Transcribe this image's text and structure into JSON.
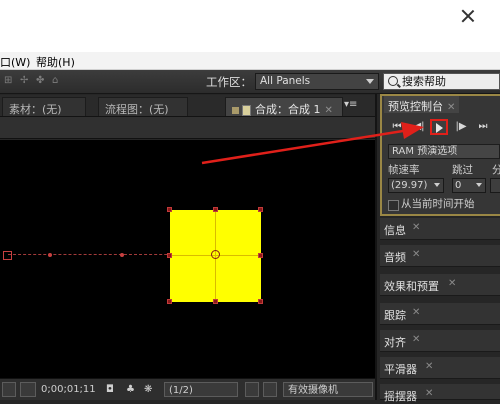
{
  "menubar": {
    "window": "口(W)",
    "help": "帮助(H)"
  },
  "toolbar": {
    "workspace_label": "工作区：",
    "workspace_value": "All Panels",
    "search_value": "搜索帮助"
  },
  "tabs": [
    {
      "label": "素材：(无)"
    },
    {
      "label": "流程图：(无)"
    },
    {
      "label": "合成：合成 1"
    }
  ],
  "viewer_bottom": {
    "timecode": "0;00;01;11",
    "resolution": "(1/2)",
    "camera": "有效摄像机"
  },
  "preview_panel": {
    "title": "预览控制台",
    "ram_button": "RAM 预演选项",
    "frame_rate_label": "帧速率",
    "skip_label": "跳过",
    "resolution_label": "分",
    "frame_rate_value": "(29.97)",
    "skip_value": "0",
    "from_current_label": "从当前时间开始"
  },
  "panels": [
    {
      "label": "信息"
    },
    {
      "label": "音频"
    },
    {
      "label": "效果和预置"
    },
    {
      "label": "跟踪"
    },
    {
      "label": "对齐"
    },
    {
      "label": "平滑器"
    },
    {
      "label": "摇摆器"
    }
  ],
  "colors": {
    "layer_fill": "#ffff00",
    "annotation": "#e0201a",
    "panel_highlight": "#9a8745"
  }
}
